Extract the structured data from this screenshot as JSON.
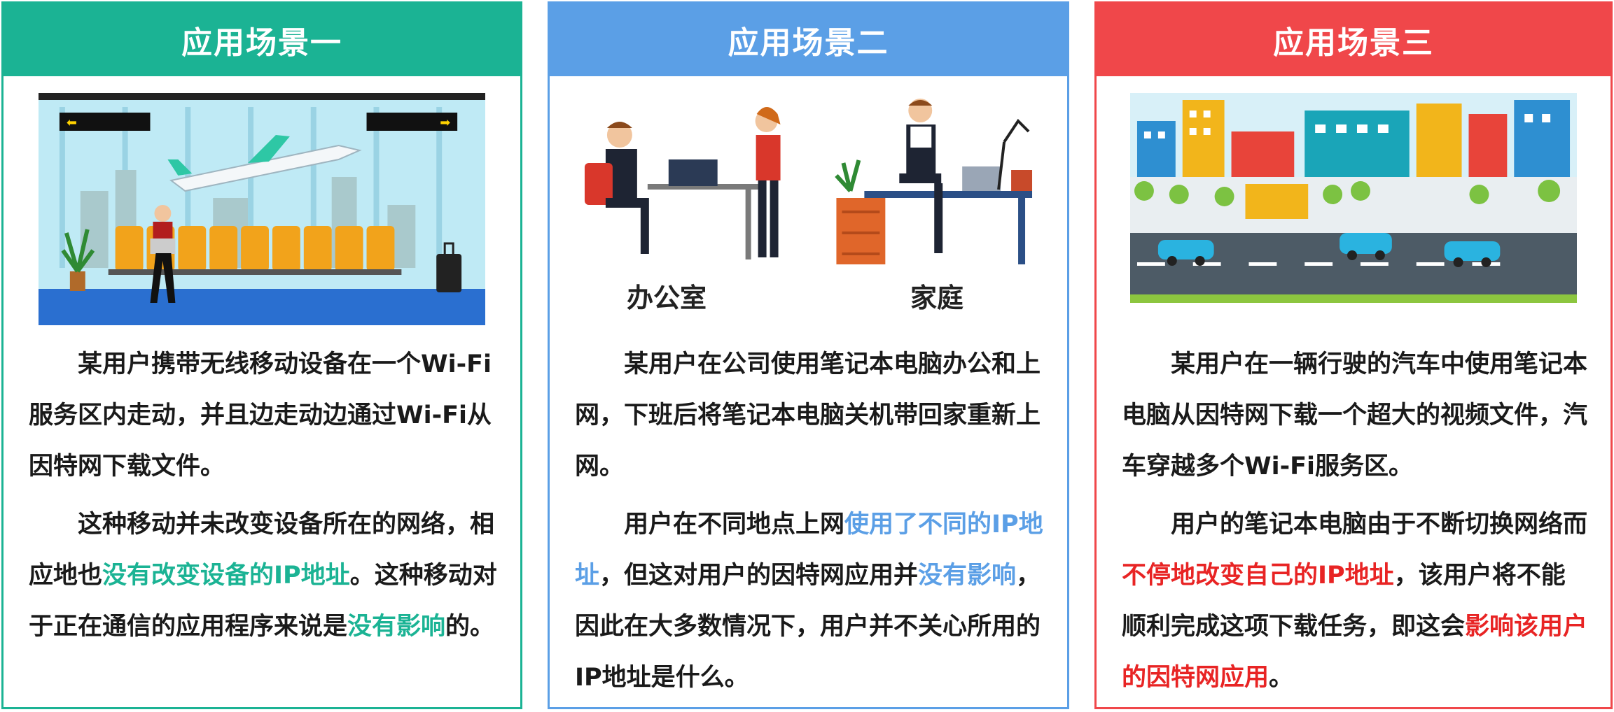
{
  "cards": [
    {
      "title": "应用场景一",
      "header_color": "#1bb394",
      "border_color": "#1bb394",
      "highlight_color": "#1bb394",
      "illustration": "airport-waiting-hall",
      "p1": "某用户携带无线移动设备在一个Wi-Fi服务区内走动，并且边走动边通过Wi-Fi从因特网下载文件。",
      "p2_a": "这种移动并未改变设备所在的网络，相应地也",
      "p2_hl1": "没有改变设备的IP地址",
      "p2_b": "。这种移动对于正在通信的应用程序来说是",
      "p2_hl2": "没有影响",
      "p2_c": "的。"
    },
    {
      "title": "应用场景二",
      "header_color": "#5b9fe6",
      "border_color": "#5b9fe6",
      "highlight_color": "#5b9fe6",
      "illustration": "office-and-home",
      "label_office": "办公室",
      "label_home": "家庭",
      "p1": "某用户在公司使用笔记本电脑办公和上网，下班后将笔记本电脑关机带回家重新上网。",
      "p2_a": "用户在不同地点上网",
      "p2_hl1": "使用了不同的IP地址",
      "p2_b": "，但这对用户的因特网应用并",
      "p2_hl2": "没有影响",
      "p2_c": "，因此在大多数情况下，用户并不关心所用的IP地址是什么。"
    },
    {
      "title": "应用场景三",
      "header_color": "#f0474a",
      "border_color": "#f0474a",
      "highlight_color": "#e82424",
      "illustration": "city-street-cars",
      "p1": "某用户在一辆行驶的汽车中使用笔记本电脑从因特网下载一个超大的视频文件，汽车穿越多个Wi-Fi服务区。",
      "p2_a": "用户的笔记本电脑由于不断切换网络而",
      "p2_hl1": "不停地改变自己的IP地址",
      "p2_b": "，该用户将不能顺利完成这项下载任务，即这会",
      "p2_hl2": "影响该用户的因特网应用",
      "p2_c": "。"
    }
  ]
}
